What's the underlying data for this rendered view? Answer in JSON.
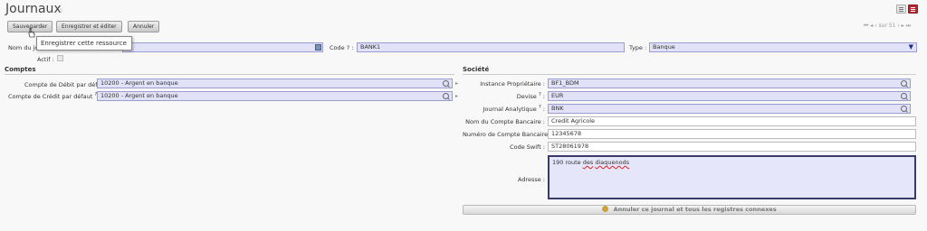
{
  "header": {
    "title": "Journaux",
    "star": "☆"
  },
  "toolbar": {
    "save_label": "Sauvegarder",
    "save_edit_label": "Enregistrer et éditer",
    "cancel_label": "Annuler",
    "pager": "⏮ ◂ ‹ sur 51 › ▸ ⏭"
  },
  "tooltip": {
    "text": "Enregistrer cette ressource"
  },
  "form": {
    "name_label": "Nom du jo",
    "name_value": "",
    "code_label": "Code ? :",
    "code_value": "BANK1",
    "type_label": "Type :",
    "type_value": "Banque",
    "actif_label": "Actif :"
  },
  "comptes": {
    "section": "Comptes",
    "debit_label": "Compte de Débit par défaut",
    "debit_value": "10200 - Argent en banque",
    "credit_label": "Compte de Crédit par défaut",
    "credit_value": "10200 - Argent en banque",
    "help_mark": "?"
  },
  "societe": {
    "section": "Société",
    "instance_label": "Instance Propriétaire :",
    "instance_value": "BF1_BDM",
    "devise_label": "Devise",
    "devise_value": "EUR",
    "journal_label": "Journal Analytique",
    "journal_value": "BNK",
    "nom_compte_label": "Nom du Compte Bancaire :",
    "nom_compte_value": "Credit Agricole",
    "num_compte_label": "Numéro de Compte Bancaire :",
    "num_compte_value": "12345678",
    "swift_label": "Code Swift :",
    "swift_value": "ST28061978",
    "adresse_label": "Adresse :",
    "adresse_word1": "190 route",
    "adresse_word2": "des",
    "adresse_word3": "diaquenods",
    "cancel_journal_label": "Annuler ce journal et tous les registres connexes"
  }
}
